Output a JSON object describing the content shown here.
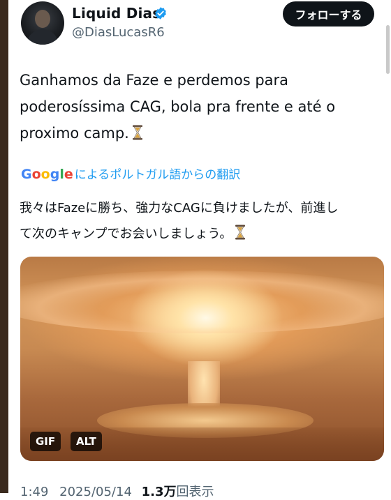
{
  "author": {
    "name": "Liquid Dias",
    "handle": "@DiasLucasR6",
    "verified": true
  },
  "follow_button": {
    "label": "フォローする"
  },
  "tweet": {
    "lines": [
      "Ganhamos da Faze e perdemos para",
      "poderosíssima CAG, bola pra frente e até o",
      "proximo camp."
    ]
  },
  "translation": {
    "provider": "Google",
    "label": "によるポルトガル語からの翻訳",
    "lines": [
      "我々はFazeに勝ち、強力なCAGに負けましたが、前進し",
      "て次のキャンプでお会いしましょう。"
    ]
  },
  "media": {
    "gif_label": "GIF",
    "alt_label": "ALT"
  },
  "footer": {
    "time": "1:49",
    "date": "2025/05/14",
    "views_count": "1.3万",
    "views_label": "回表示"
  },
  "colors": {
    "verified": "#1d9bf0",
    "link": "#1d9bf0",
    "follow_bg": "#0f1419"
  },
  "icons": [
    "verified-badge-icon",
    "hourglass-icon"
  ]
}
